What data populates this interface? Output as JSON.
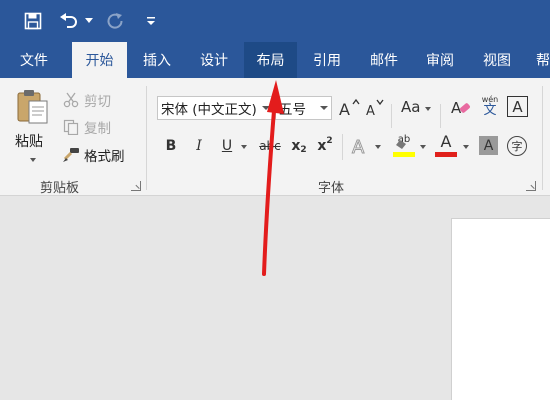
{
  "tabs": [
    {
      "label": "文件"
    },
    {
      "label": "开始"
    },
    {
      "label": "插入"
    },
    {
      "label": "设计"
    },
    {
      "label": "布局"
    },
    {
      "label": "引用"
    },
    {
      "label": "邮件"
    },
    {
      "label": "审阅"
    },
    {
      "label": "视图"
    },
    {
      "label": "帮"
    }
  ],
  "active_tab": "开始",
  "highlighted_tab": "布局",
  "clipboard": {
    "paste_label": "粘贴",
    "cut_label": "剪切",
    "copy_label": "复制",
    "format_painter_label": "格式刷",
    "group_label": "剪贴板"
  },
  "font": {
    "font_name": "宋体 (中文正文)",
    "font_size": "五号",
    "change_case_label": "Aa",
    "bold": "B",
    "italic": "I",
    "underline": "U",
    "strikethrough": "abc",
    "subscript_base": "x",
    "subscript_sub": "2",
    "superscript_base": "x",
    "superscript_sup": "2",
    "phonetic_top": "wén",
    "phonetic_bottom": "文",
    "char_border": "A",
    "enclose_char": "字",
    "highlight_text": "ab",
    "font_color_text": "A",
    "group_label": "字体"
  },
  "colors": {
    "title_bar": "#2b579a",
    "ribbon": "#f3f3f3",
    "highlight_yellow": "#ffff00",
    "font_color_red": "#e0201b",
    "annotation_arrow": "#e31c1c"
  }
}
